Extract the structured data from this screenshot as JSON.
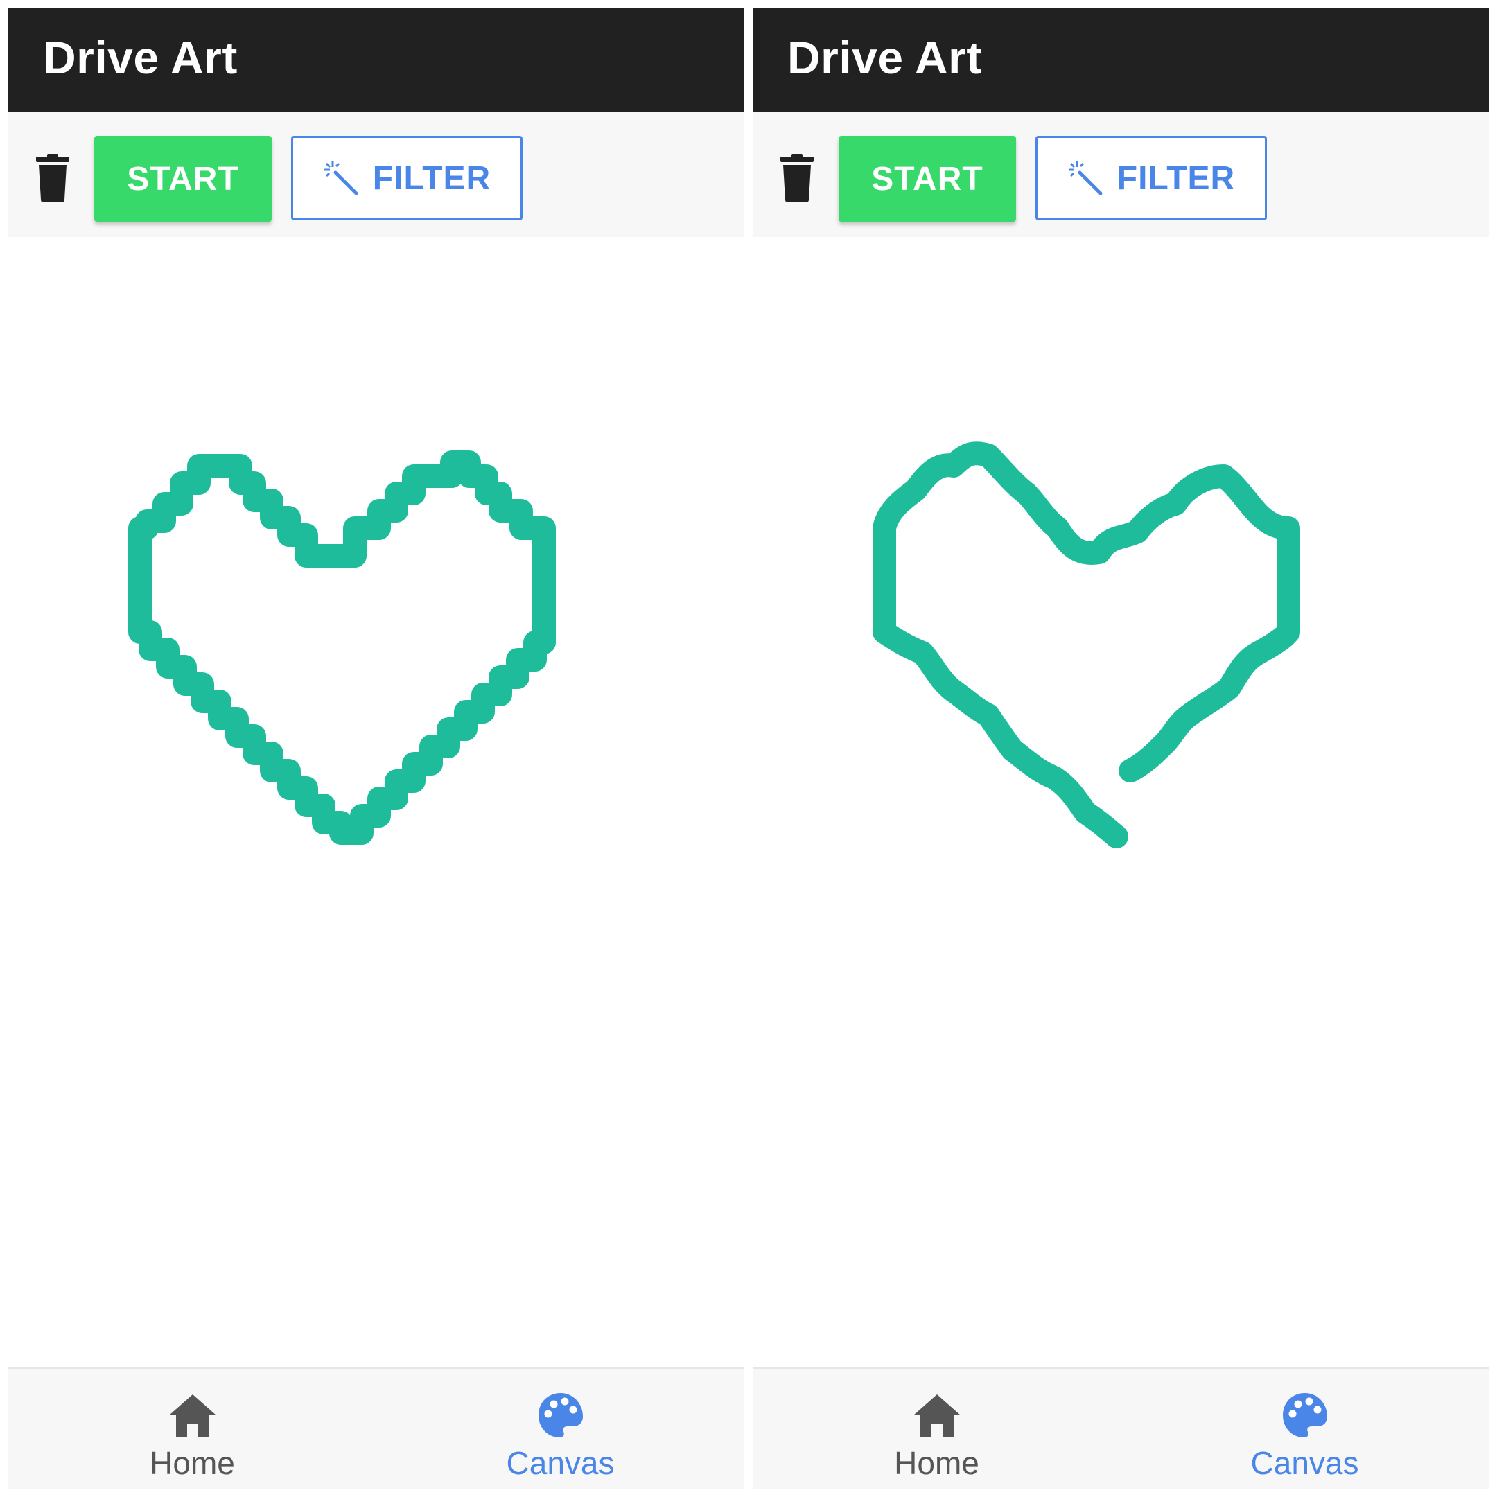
{
  "colors": {
    "appbar": "#212121",
    "start_button": "#37d96b",
    "accent_blue": "#4a86e8",
    "stroke_teal": "#1fbc9c",
    "inactive_nav": "#555555"
  },
  "panels": [
    {
      "app_title": "Drive Art",
      "toolbar": {
        "start_label": "START",
        "filter_label": "FILTER"
      },
      "nav": {
        "home_label": "Home",
        "canvas_label": "Canvas",
        "active": "Canvas"
      },
      "drawing": {
        "shape": "heart",
        "style": "pixelated"
      }
    },
    {
      "app_title": "Drive Art",
      "toolbar": {
        "start_label": "START",
        "filter_label": "FILTER"
      },
      "nav": {
        "home_label": "Home",
        "canvas_label": "Canvas",
        "active": "Canvas"
      },
      "drawing": {
        "shape": "heart",
        "style": "smoothed"
      }
    }
  ]
}
